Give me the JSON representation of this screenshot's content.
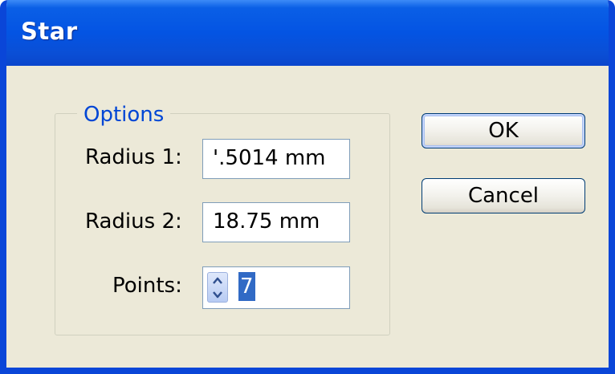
{
  "window": {
    "title": "Star"
  },
  "options": {
    "legend": "Options",
    "radius1_label": "Radius 1:",
    "radius1_value": "'.5014 mm",
    "radius2_label": "Radius 2:",
    "radius2_value": "18.75 mm",
    "points_label": "Points:",
    "points_value": "7"
  },
  "buttons": {
    "ok_label": "OK",
    "cancel_label": "Cancel"
  },
  "icons": {
    "spinner_up": "chevron-up-icon",
    "spinner_down": "chevron-down-icon"
  },
  "colors": {
    "titlebar": "#0454e3",
    "legend_text": "#0046d5",
    "selection": "#316ac5",
    "dialog_bg": "#ece9d8"
  }
}
